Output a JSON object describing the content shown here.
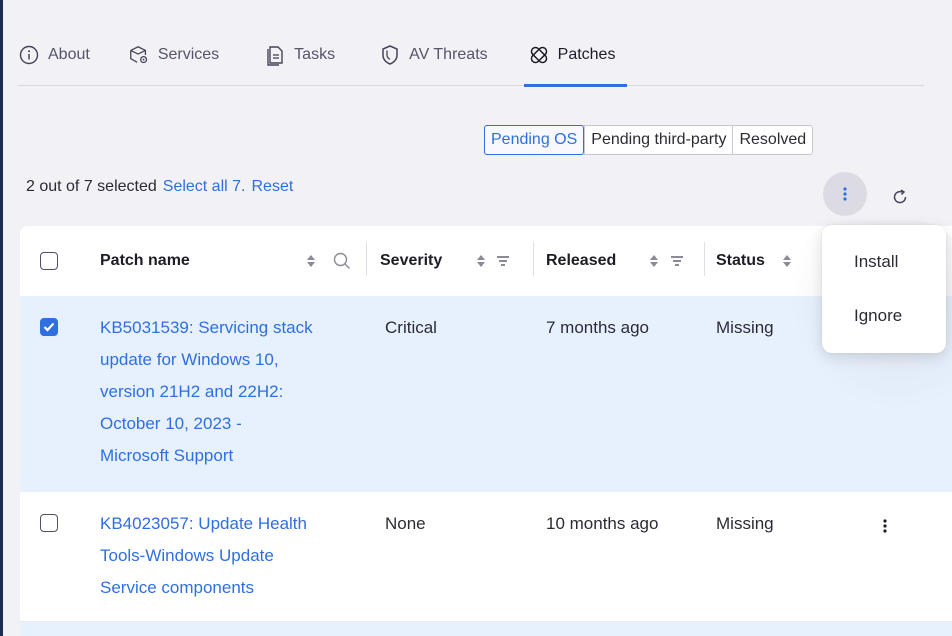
{
  "tabs": [
    {
      "label": "About",
      "icon": "info-circle-icon"
    },
    {
      "label": "Services",
      "icon": "services-gear-icon"
    },
    {
      "label": "Tasks",
      "icon": "tasks-document-icon"
    },
    {
      "label": "AV Threats",
      "icon": "shield-icon"
    },
    {
      "label": "Patches",
      "icon": "patch-bandage-icon",
      "active": true
    }
  ],
  "filters": {
    "options": [
      "Pending OS",
      "Pending third-party",
      "Resolved"
    ],
    "selected": "Pending OS"
  },
  "selection": {
    "summary": "2 out of 7 selected",
    "select_all": "Select all 7.",
    "reset": "Reset"
  },
  "table": {
    "columns": {
      "patch_name": "Patch name",
      "severity": "Severity",
      "released": "Released",
      "status": "Status"
    },
    "rows": [
      {
        "checked": true,
        "name_lines": [
          "KB5031539: Servicing stack",
          "update for Windows 10,",
          "version 21H2 and 22H2:",
          "October 10, 2023 -",
          "Microsoft Support"
        ],
        "severity": "Critical",
        "released": "7 months ago",
        "status": "Missing"
      },
      {
        "checked": false,
        "name_lines": [
          "KB4023057: Update Health",
          "Tools-Windows Update",
          "Service components"
        ],
        "severity": "None",
        "released": "10 months ago",
        "status": "Missing"
      }
    ]
  },
  "actions_menu": {
    "items": [
      "Install",
      "Ignore"
    ]
  },
  "colors": {
    "accent": "#2f6fe0",
    "selected_row": "#e6f1fd",
    "background": "#f2f1f6"
  }
}
